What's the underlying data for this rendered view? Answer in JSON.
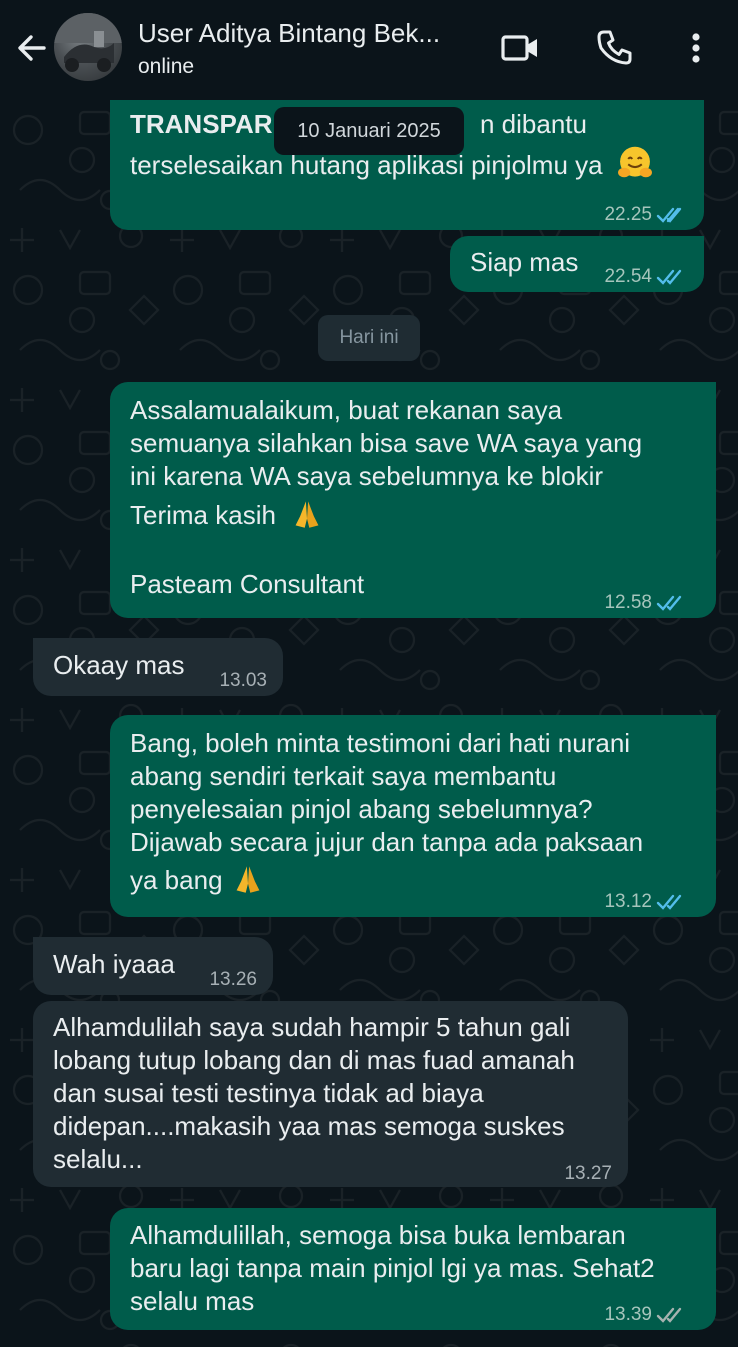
{
  "header": {
    "contact_name": "User Aditya Bintang Bek...",
    "status": "online",
    "icons": [
      "back-arrow-icon",
      "video-call-icon",
      "voice-call-icon",
      "more-options-icon"
    ]
  },
  "date_pills": {
    "floating_date": "10 Januari 2025",
    "today": "Hari ini"
  },
  "messages": [
    {
      "dir": "out",
      "lines": [
        "TRANSPAR",
        "terselesaikan hutang aplikasi pinjolmu ya"
      ],
      "partial_right": "n dibantu",
      "time": "22.25",
      "read": true
    },
    {
      "dir": "out",
      "lines": [
        "Siap mas"
      ],
      "time": "22.54",
      "read": true
    },
    {
      "dir": "out",
      "lines": [
        "Assalamualaikum, buat rekanan saya",
        "semuanya silahkan bisa save WA saya yang",
        "ini karena WA saya sebelumnya ke blokir",
        "Terima kasih",
        "",
        "Pasteam Consultant"
      ],
      "time": "12.58",
      "read": true
    },
    {
      "dir": "in",
      "lines": [
        "Okaay mas"
      ],
      "time": "13.03"
    },
    {
      "dir": "out",
      "lines": [
        "Bang, boleh minta testimoni dari hati nurani",
        "abang sendiri terkait saya membantu",
        "penyelesaian pinjol abang sebelumnya?",
        "Dijawab secara jujur dan tanpa ada paksaan",
        "ya bang"
      ],
      "time": "13.12",
      "read": true
    },
    {
      "dir": "in",
      "lines": [
        "Wah iyaaa"
      ],
      "time": "13.26"
    },
    {
      "dir": "in",
      "lines": [
        "Alhamdulilah saya sudah hampir 5 tahun gali",
        "lobang tutup lobang dan di mas fuad amanah",
        "dan susai testi testinya tidak ad biaya",
        "didepan....makasih yaa mas semoga suskes",
        "selalu..."
      ],
      "time": "13.27"
    },
    {
      "dir": "out",
      "lines": [
        "Alhamdulillah, semoga bisa buka lembaran",
        "baru lagi tanpa main pinjol lgi ya mas. Sehat2",
        "selalu mas"
      ],
      "time": "13.39",
      "read": false
    }
  ],
  "colors": {
    "background": "#0b141a",
    "outgoing_bubble": "#005c4b",
    "incoming_bubble": "#202c33",
    "read_tick": "#53bdeb",
    "delivered_tick": "#a6b3b0"
  }
}
